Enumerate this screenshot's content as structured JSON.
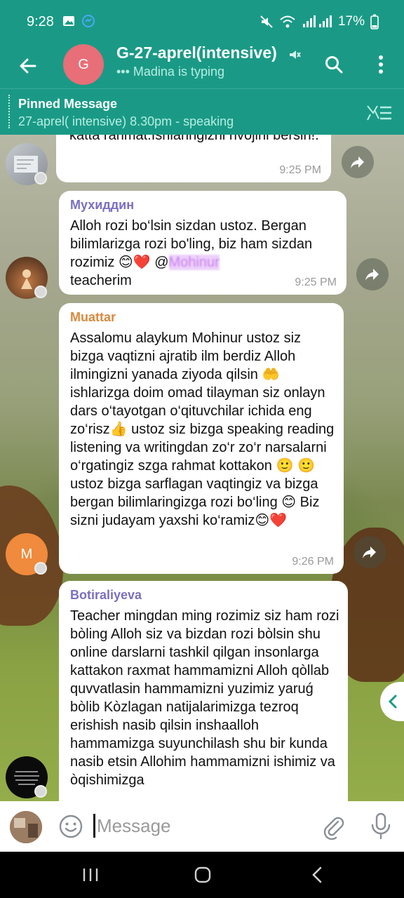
{
  "status_bar": {
    "time": "9:28",
    "battery": "17%"
  },
  "header": {
    "avatar_letter": "G",
    "title": "G-27-aprel(intensive)",
    "typing_status": "••• Madina is typing"
  },
  "pinned": {
    "title": "Pinned Message",
    "text": "27-aprel( intensive) 8.30pm - speaking"
  },
  "messages": [
    {
      "sender": "",
      "text": "katta rahmat.Ishlaringizni rivojini bersin!.",
      "time": "9:25 PM"
    },
    {
      "sender": "Мухиддин",
      "sender_color": "#7b6fc2",
      "text": "Alloh rozi bo‘lsin sizdan ustoz. Bergan bilimlarizga rozi bo'ling, biz ham sizdan rozimiz 😊❤️ @",
      "mention": "Mohinur",
      "text_end": "teacherim",
      "time": "9:25 PM"
    },
    {
      "sender": "Muattar",
      "sender_color": "#d8893e",
      "avatar_letter": "M",
      "text": "Assalomu alaykum Mohinur ustoz siz bizga vaqtizni ajratib ilm berdiz Alloh ilmingizni yanada ziyoda qilsin 🤲 ishlarizga doim omad tilayman siz onlayn dars o‘tayotgan o‘qituvchilar ichida eng zo‘risz👍 ustoz siz bizga speaking reading listening va writingdan zo‘r zo‘r narsalarni o‘rgatingiz szga rahmat kottakon 🙂 🙂 ustoz bizga sarflagan vaqtingiz va bizga bergan bilimlaringizga rozi bo‘ling 😊 Biz sizni judayam yaxshi ko‘ramiz😊❤️",
      "time": "9:26 PM"
    },
    {
      "sender": "Botiraliyeva",
      "sender_color": "#7b6fc2",
      "text": "Teacher mingdan ming rozimiz siz ham rozi bòling Alloh siz va bizdan rozi bòlsin shu online darslarni tashkil qilgan insonlarga kattakon raxmat hammamizni Alloh qòllab quvvatlasin hammamizni yuzimiz yaruǵ bòlib Kòzlagan natijalarimizga tezroq erishish nasib qilsin inshaalloh hammamizga suyunchilash  shu bir kunda nasib etsin Allohim hammamizni ishimiz va òqishimizga"
    }
  ],
  "input": {
    "placeholder": "Message"
  },
  "colors": {
    "header": "#1a9a86",
    "accent_light": "#b5eee3",
    "avatar_group": "#e86e78",
    "avatar_m": "#f08a3c"
  }
}
